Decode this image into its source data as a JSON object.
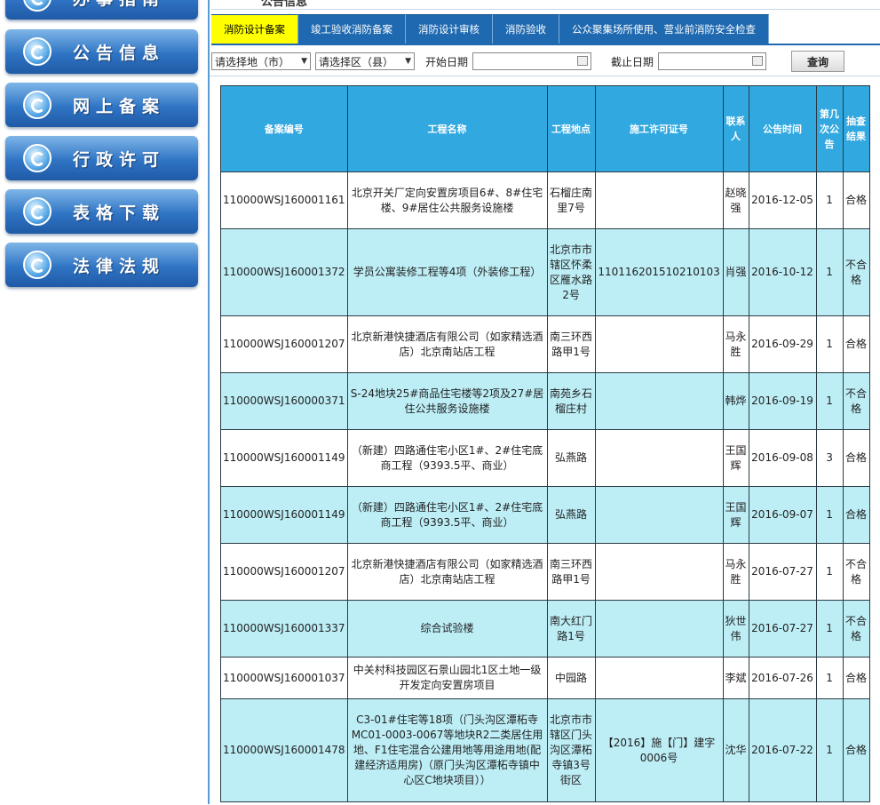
{
  "sidebar": {
    "items": [
      {
        "label": "办事指南"
      },
      {
        "label": "公告信息"
      },
      {
        "label": "网上备案"
      },
      {
        "label": "行政许可"
      },
      {
        "label": "表格下载"
      },
      {
        "label": "法律法规"
      }
    ]
  },
  "breadcrumb": "公告信息",
  "tabs": [
    {
      "label": "消防设计备案",
      "active": true
    },
    {
      "label": "竣工验收消防备案",
      "active": false
    },
    {
      "label": "消防设计审核",
      "active": false
    },
    {
      "label": "消防验收",
      "active": false
    },
    {
      "label": "公众聚集场所使用、营业前消防安全检查",
      "active": false
    }
  ],
  "filters": {
    "city_select": "请选择地（市）",
    "district_select": "请选择区（县）",
    "start_label": "开始日期",
    "end_label": "截止日期",
    "start_value": "",
    "end_value": "",
    "query_button": "查询"
  },
  "table": {
    "headers": [
      "备案编号",
      "工程名称",
      "工程地点",
      "施工许可证号",
      "联系人",
      "公告时间",
      "第几次公告",
      "抽查结果"
    ],
    "rows": [
      {
        "id": "110000WSJ160001161",
        "name": "北京开关厂定向安置房项目6#、8#住宅楼、9#居住公共服务设施楼",
        "location": "石榴庄南里7号",
        "permit": "",
        "contact": "赵晓强",
        "date": "2016-12-05",
        "round": "1",
        "result": "合格"
      },
      {
        "id": "110000WSJ160001372",
        "name": "学员公寓装修工程等4项（外装修工程）",
        "location": "北京市市辖区怀柔区雁水路2号",
        "permit": "110116201510210103",
        "contact": "肖强",
        "date": "2016-10-12",
        "round": "1",
        "result": "不合格"
      },
      {
        "id": "110000WSJ160001207",
        "name": "北京新港快捷酒店有限公司（如家精选酒店）北京南站店工程",
        "location": "南三环西路甲1号",
        "permit": "",
        "contact": "马永胜",
        "date": "2016-09-29",
        "round": "1",
        "result": "合格"
      },
      {
        "id": "110000WSJ160000371",
        "name": "S-24地块25#商品住宅楼等2项及27#居住公共服务设施楼",
        "location": "南苑乡石榴庄村",
        "permit": "",
        "contact": "韩烨",
        "date": "2016-09-19",
        "round": "1",
        "result": "不合格"
      },
      {
        "id": "110000WSJ160001149",
        "name": "（新建）四路通住宅小区1#、2#住宅底商工程（9393.5平、商业）",
        "location": "弘燕路",
        "permit": "",
        "contact": "王国辉",
        "date": "2016-09-08",
        "round": "3",
        "result": "合格"
      },
      {
        "id": "110000WSJ160001149",
        "name": "（新建）四路通住宅小区1#、2#住宅底商工程（9393.5平、商业）",
        "location": "弘燕路",
        "permit": "",
        "contact": "王国辉",
        "date": "2016-09-07",
        "round": "1",
        "result": "合格"
      },
      {
        "id": "110000WSJ160001207",
        "name": "北京新港快捷酒店有限公司（如家精选酒店）北京南站店工程",
        "location": "南三环西路甲1号",
        "permit": "",
        "contact": "马永胜",
        "date": "2016-07-27",
        "round": "1",
        "result": "不合格"
      },
      {
        "id": "110000WSJ160001337",
        "name": "综合试验楼",
        "location": "南大红门路1号",
        "permit": "",
        "contact": "狄世伟",
        "date": "2016-07-27",
        "round": "1",
        "result": "不合格"
      },
      {
        "id": "110000WSJ160001037",
        "name": "中关村科技园区石景山园北1区土地一级开发定向安置房项目",
        "location": "中园路",
        "permit": "",
        "contact": "李斌",
        "date": "2016-07-26",
        "round": "1",
        "result": "合格"
      },
      {
        "id": "110000WSJ160001478",
        "name": "C3-01#住宅等18项（门头沟区潭柘寺MC01-0003-0067等地块R2二类居住用地、F1住宅混合公建用地等用途用地(配建经济适用房)（原门头沟区潭柘寺镇中心区C地块项目））",
        "location": "北京市市辖区门头沟区潭柘寺镇3号街区",
        "permit": "【2016】施【门】建字0006号",
        "contact": "沈华",
        "date": "2016-07-22",
        "round": "1",
        "result": "合格"
      }
    ]
  }
}
